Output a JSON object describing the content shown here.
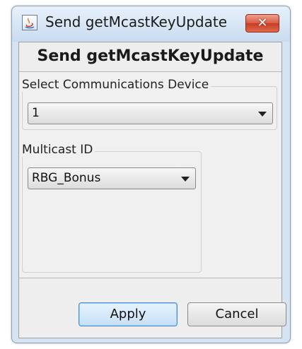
{
  "window": {
    "title": "Send getMcastKeyUpdate",
    "close_glyph": "✕"
  },
  "dialog": {
    "heading": "Send getMcastKeyUpdate"
  },
  "device_group": {
    "label": "Select Communications Device",
    "selected_value": "1"
  },
  "mcast_group": {
    "label": "Multicast ID",
    "selected_value": "RBG_Bonus"
  },
  "buttons": {
    "apply_label": "Apply",
    "cancel_label": "Cancel"
  },
  "icons": {
    "app": "java-app-icon",
    "close": "close-icon",
    "dropdown": "chevron-down-icon"
  },
  "colors": {
    "titlebar": "#c9dbef",
    "close_button": "#d85b43",
    "apply_border": "#4d8ad0"
  }
}
